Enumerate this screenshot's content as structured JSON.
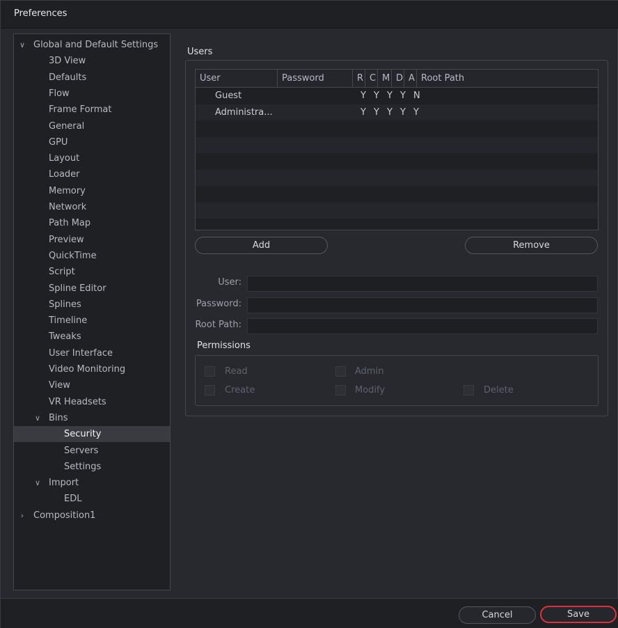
{
  "window": {
    "title": "Preferences"
  },
  "tree": {
    "items": [
      {
        "label": "Global and Default Settings",
        "chevron": "expanded"
      },
      {
        "label": "3D View"
      },
      {
        "label": "Defaults"
      },
      {
        "label": "Flow"
      },
      {
        "label": "Frame Format"
      },
      {
        "label": "General"
      },
      {
        "label": "GPU"
      },
      {
        "label": "Layout"
      },
      {
        "label": "Loader"
      },
      {
        "label": "Memory"
      },
      {
        "label": "Network"
      },
      {
        "label": "Path Map"
      },
      {
        "label": "Preview"
      },
      {
        "label": "QuickTime"
      },
      {
        "label": "Script"
      },
      {
        "label": "Spline Editor"
      },
      {
        "label": "Splines"
      },
      {
        "label": "Timeline"
      },
      {
        "label": "Tweaks"
      },
      {
        "label": "User Interface"
      },
      {
        "label": "Video Monitoring"
      },
      {
        "label": "View"
      },
      {
        "label": "VR Headsets"
      },
      {
        "label": "Bins",
        "chevron": "expanded"
      },
      {
        "label": "Security",
        "selected": true
      },
      {
        "label": "Servers"
      },
      {
        "label": "Settings"
      },
      {
        "label": "Import",
        "chevron": "expanded"
      },
      {
        "label": "EDL"
      },
      {
        "label": "Composition1",
        "chevron": "collapsed"
      }
    ]
  },
  "users": {
    "section_label": "Users",
    "columns": [
      "User",
      "Password",
      "R",
      "C",
      "M",
      "D",
      "A",
      "Root Path"
    ],
    "rows": [
      {
        "user": "Guest",
        "password": "",
        "r": "Y",
        "c": "Y",
        "m": "Y",
        "d": "Y",
        "a": "N",
        "root_path": ""
      },
      {
        "user": "Administra...",
        "password": "",
        "r": "Y",
        "c": "Y",
        "m": "Y",
        "d": "Y",
        "a": "Y",
        "root_path": ""
      }
    ],
    "add_label": "Add",
    "remove_label": "Remove"
  },
  "form": {
    "user_label": "User:",
    "password_label": "Password:",
    "root_path_label": "Root Path:",
    "user_value": "",
    "password_value": "",
    "root_path_value": ""
  },
  "permissions": {
    "section_label": "Permissions",
    "read": "Read",
    "admin": "Admin",
    "create": "Create",
    "modify": "Modify",
    "delete": "Delete"
  },
  "footer": {
    "cancel_label": "Cancel",
    "save_label": "Save"
  },
  "colors": {
    "accent": "#d9323c",
    "selection": "#3a3b41",
    "background": "#28292e"
  }
}
